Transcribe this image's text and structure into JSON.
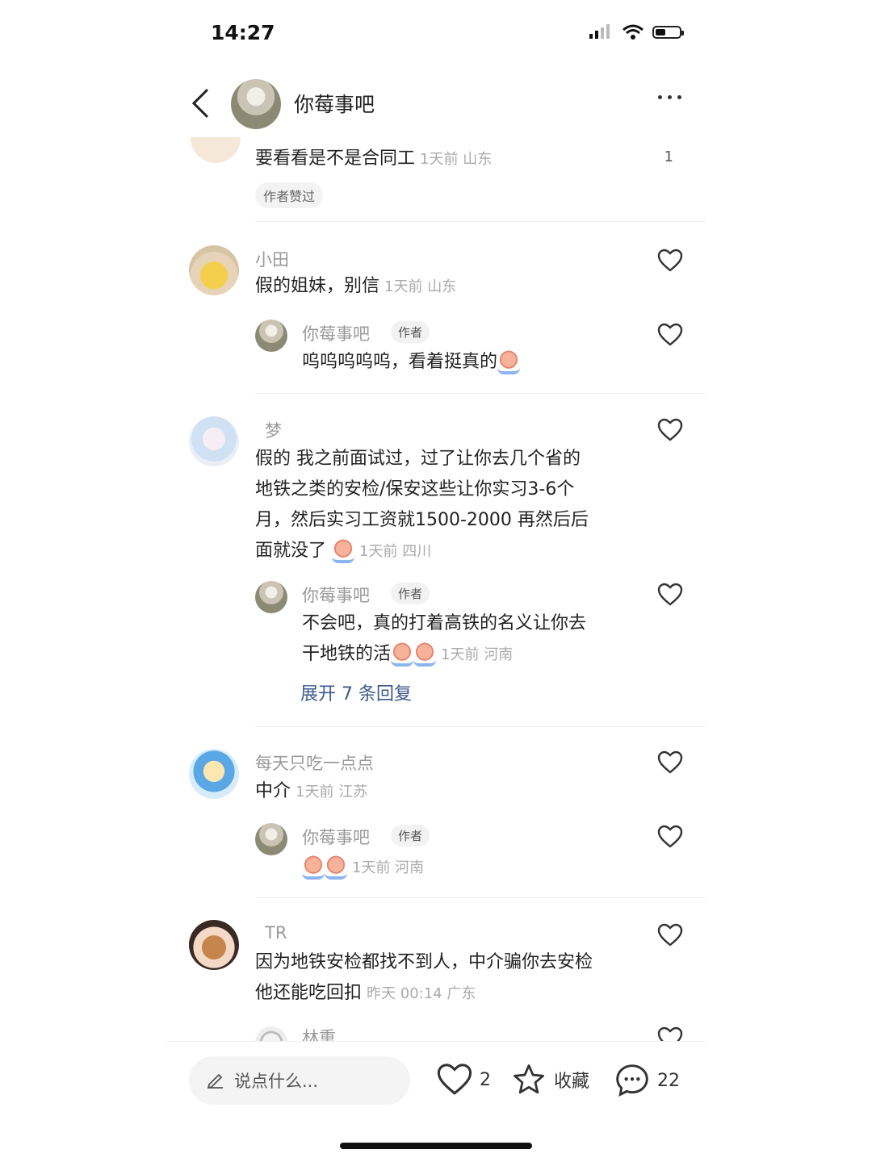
{
  "status_bar": {
    "time": "14:27"
  },
  "header": {
    "title": "你莓事吧"
  },
  "comments": [
    {
      "text": "要看看是不是合同工",
      "meta": "1天前 山东",
      "count": "1",
      "badge": "作者赞过"
    },
    {
      "user": "小田",
      "text": "假的姐妹，别信",
      "meta": "1天前 山东",
      "reply": {
        "user": "你莓事吧",
        "tag": "作者",
        "text": "呜呜呜呜呜，看着挺真的"
      }
    },
    {
      "user": "梦",
      "lines": [
        "假的  我之前面试过，过了让你去几个省的",
        "地铁之类的安检/保安这些让你实习3-6个",
        "月，然后实习工资就1500-2000  再然后后",
        "面就没了"
      ],
      "meta": "1天前 四川",
      "reply": {
        "user": "你莓事吧",
        "tag": "作者",
        "lines": [
          "不会吧，真的打着高铁的名义让你去",
          "干地铁的活"
        ],
        "meta": "1天前 河南"
      },
      "expand": "展开 7 条回复"
    },
    {
      "user": "每天只吃一点点",
      "text": "中介",
      "meta": "1天前 江苏",
      "reply": {
        "user": "你莓事吧",
        "tag": "作者",
        "meta": "1天前 河南"
      }
    },
    {
      "user": "TR",
      "lines": [
        "因为地铁安检都找不到人，中介骗你去安检",
        "他还能吃回扣"
      ],
      "meta": "昨天 00:14 广东"
    },
    {
      "user": "林重"
    }
  ],
  "bottom_bar": {
    "placeholder": "说点什么...",
    "like_count": "2",
    "collect_label": "收藏",
    "comment_count": "22"
  },
  "colors": {
    "link": "#3d5a8a",
    "muted": "#9a9a9a"
  }
}
